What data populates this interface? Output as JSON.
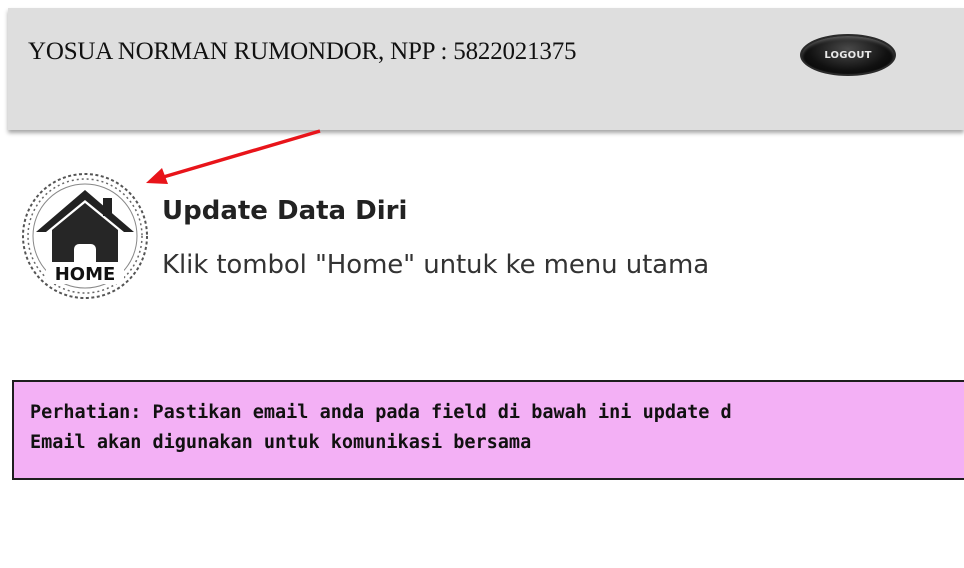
{
  "header": {
    "user_info": "YOSUA NORMAN RUMONDOR, NPP : 5822021375",
    "logout_label": "LOGOUT"
  },
  "home": {
    "icon": "home-icon",
    "icon_label": "HOME"
  },
  "page": {
    "title": "Update Data Diri",
    "subtitle": "Klik tombol \"Home\" untuk ke menu utama"
  },
  "notice": {
    "line1": "Perhatian: Pastikan email anda pada field di bawah ini update d",
    "line2": "Email akan digunakan untuk komunikasi bersama",
    "background": "#f3b0f5"
  },
  "annotation": {
    "arrow_color": "#e8141a"
  }
}
